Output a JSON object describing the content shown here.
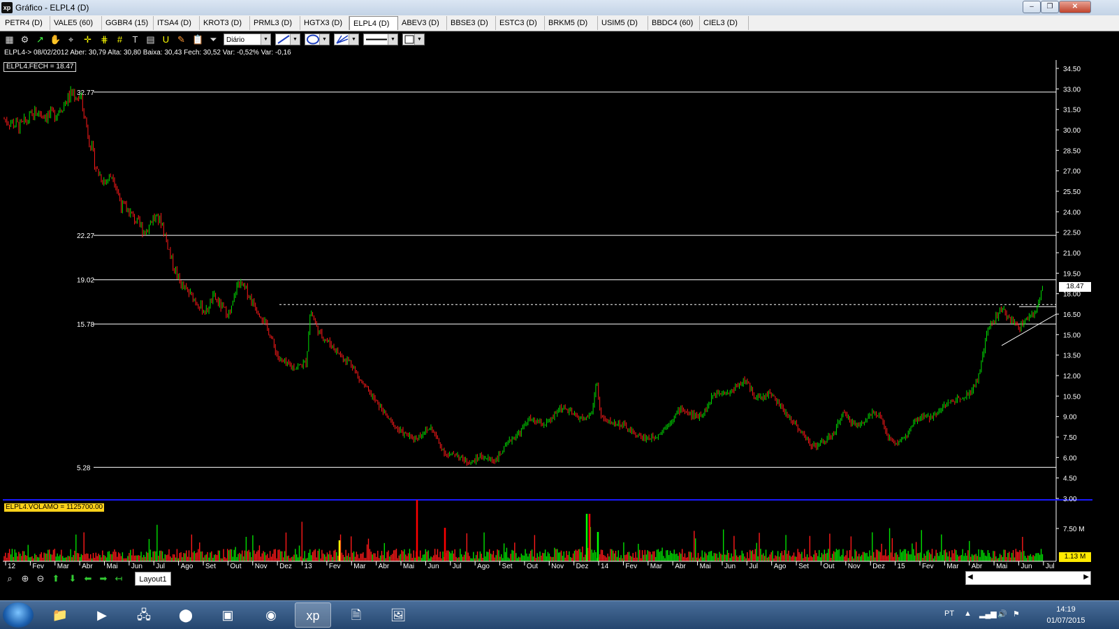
{
  "window": {
    "logo": "xp",
    "title": "Gráfico - ELPL4 (D)"
  },
  "tabs": [
    "PETR4 (D)",
    "VALE5 (60)",
    "GGBR4 (15)",
    "ITSA4 (D)",
    "KROT3 (D)",
    "PRML3 (D)",
    "HGTX3 (D)",
    "ELPL4 (D)",
    "ABEV3 (D)",
    "BBSE3 (D)",
    "ESTC3 (D)",
    "BRKM5 (D)",
    "USIM5 (D)",
    "BBDC4 (60)",
    "CIEL3 (D)"
  ],
  "active_tab": "ELPL4 (D)",
  "toolbar": {
    "period_select": "Diário"
  },
  "info_line": "ELPL4-> 08/02/2012 Aber: 30,79 Alta: 30,80 Baixa: 30,43 Fech: 30,52 Var: -0,52% Var: -0,16",
  "price_legend": "ELPL4.FECH = 18.47",
  "volume_legend": "ELPL4.VOLAMO = 1125700.00",
  "last_price_badge": "18.47",
  "volume_badge": "1.13 M",
  "layout_tab": "Layout1",
  "taskbar": {
    "lang": "PT",
    "time": "14:19",
    "date": "01/07/2015"
  },
  "colors": {
    "up": "#00e000",
    "down": "#ff1a1a",
    "line": "#ffffff",
    "volume_separator": "#1a1aff"
  },
  "chart_data": {
    "type": "candlestick",
    "price_axis": {
      "labels": [
        "34.50",
        "33.00",
        "31.50",
        "30.00",
        "28.50",
        "27.00",
        "25.50",
        "24.00",
        "22.50",
        "21.00",
        "19.50",
        "18.00",
        "16.50",
        "15.00",
        "13.50",
        "12.00",
        "10.50",
        "9.00",
        "7.50",
        "6.00",
        "4.50",
        "3.00"
      ],
      "range": [
        3.0,
        34.5
      ]
    },
    "volume_axis": {
      "labels": [
        "7.50 M"
      ]
    },
    "time_axis": [
      "12",
      "Fev",
      "Mar",
      "Abr",
      "Mai",
      "Jun",
      "Jul",
      "Ago",
      "Set",
      "Out",
      "Nov",
      "Dez",
      "13",
      "Fev",
      "Mar",
      "Abr",
      "Mai",
      "Jun",
      "Jul",
      "Ago",
      "Set",
      "Out",
      "Nov",
      "Dez",
      "14",
      "Fev",
      "Mar",
      "Abr",
      "Mai",
      "Jun",
      "Jul",
      "Ago",
      "Set",
      "Out",
      "Nov",
      "Dez",
      "15",
      "Fev",
      "Mar",
      "Abr",
      "Mai",
      "Jun",
      "Jul"
    ],
    "horizontal_levels": [
      {
        "value": 32.77,
        "label": "32.77"
      },
      {
        "value": 22.27,
        "label": "22.27"
      },
      {
        "value": 19.02,
        "label": "19.02"
      },
      {
        "value": 15.78,
        "label": "15.78"
      },
      {
        "value": 5.28,
        "label": "5.28"
      }
    ],
    "dashed_level": 17.2,
    "trend_price_path": [
      [
        0,
        30.8
      ],
      [
        4,
        30.2
      ],
      [
        8,
        31.3
      ],
      [
        12,
        31.0
      ],
      [
        15,
        32.0
      ],
      [
        17,
        32.7
      ],
      [
        19,
        32.3
      ],
      [
        21,
        29.5
      ],
      [
        23,
        27.0
      ],
      [
        25,
        26.2
      ],
      [
        27,
        26.8
      ],
      [
        29,
        24.5
      ],
      [
        31,
        24.0
      ],
      [
        33,
        23.2
      ],
      [
        35,
        22.5
      ],
      [
        37,
        23.6
      ],
      [
        39,
        23.3
      ],
      [
        40,
        22.2
      ],
      [
        42,
        20.0
      ],
      [
        44,
        18.6
      ],
      [
        46,
        18.0
      ],
      [
        48,
        17.3
      ],
      [
        50,
        16.6
      ],
      [
        52,
        17.8
      ],
      [
        54,
        17.0
      ],
      [
        56,
        16.4
      ],
      [
        58,
        18.8
      ],
      [
        60,
        18.3
      ],
      [
        62,
        17.2
      ],
      [
        64,
        16.3
      ],
      [
        66,
        15.0
      ],
      [
        68,
        13.3
      ],
      [
        70,
        12.8
      ],
      [
        72,
        12.6
      ],
      [
        74,
        12.8
      ],
      [
        75,
        13.0
      ],
      [
        76,
        16.8
      ],
      [
        78,
        15.2
      ],
      [
        80,
        14.6
      ],
      [
        82,
        14.0
      ],
      [
        84,
        13.3
      ],
      [
        86,
        13.0
      ],
      [
        88,
        11.8
      ],
      [
        90,
        11.0
      ],
      [
        92,
        10.2
      ],
      [
        94,
        9.4
      ],
      [
        96,
        8.6
      ],
      [
        98,
        8.0
      ],
      [
        100,
        7.6
      ],
      [
        102,
        7.4
      ],
      [
        104,
        7.8
      ],
      [
        106,
        8.2
      ],
      [
        108,
        7.0
      ],
      [
        110,
        6.1
      ],
      [
        112,
        6.3
      ],
      [
        114,
        5.8
      ],
      [
        116,
        5.6
      ],
      [
        118,
        6.1
      ],
      [
        120,
        5.9
      ],
      [
        122,
        5.8
      ],
      [
        124,
        6.6
      ],
      [
        126,
        7.4
      ],
      [
        128,
        7.8
      ],
      [
        130,
        8.8
      ],
      [
        132,
        8.6
      ],
      [
        134,
        8.4
      ],
      [
        136,
        8.8
      ],
      [
        138,
        9.7
      ],
      [
        140,
        9.4
      ],
      [
        142,
        9.0
      ],
      [
        144,
        8.8
      ],
      [
        146,
        9.3
      ],
      [
        147,
        11.8
      ],
      [
        148,
        9.0
      ],
      [
        150,
        8.6
      ],
      [
        152,
        8.5
      ],
      [
        154,
        8.3
      ],
      [
        156,
        7.8
      ],
      [
        158,
        7.5
      ],
      [
        160,
        7.4
      ],
      [
        162,
        7.6
      ],
      [
        164,
        8.2
      ],
      [
        166,
        8.9
      ],
      [
        168,
        9.6
      ],
      [
        170,
        9.2
      ],
      [
        172,
        9.0
      ],
      [
        174,
        9.4
      ],
      [
        176,
        10.6
      ],
      [
        178,
        10.9
      ],
      [
        180,
        10.7
      ],
      [
        182,
        11.3
      ],
      [
        184,
        11.7
      ],
      [
        186,
        10.6
      ],
      [
        188,
        10.3
      ],
      [
        190,
        10.8
      ],
      [
        192,
        10.0
      ],
      [
        194,
        9.2
      ],
      [
        196,
        8.6
      ],
      [
        198,
        7.8
      ],
      [
        200,
        7.0
      ],
      [
        202,
        6.9
      ],
      [
        204,
        7.3
      ],
      [
        206,
        7.7
      ],
      [
        208,
        9.3
      ],
      [
        210,
        8.7
      ],
      [
        212,
        8.3
      ],
      [
        214,
        8.8
      ],
      [
        216,
        9.5
      ],
      [
        218,
        8.6
      ],
      [
        220,
        7.2
      ],
      [
        222,
        7.1
      ],
      [
        224,
        7.6
      ],
      [
        226,
        8.6
      ],
      [
        228,
        9.0
      ],
      [
        230,
        8.9
      ],
      [
        232,
        9.5
      ],
      [
        234,
        9.9
      ],
      [
        236,
        10.2
      ],
      [
        238,
        10.5
      ],
      [
        240,
        10.8
      ],
      [
        242,
        12.0
      ],
      [
        244,
        15.2
      ],
      [
        246,
        16.3
      ],
      [
        248,
        16.8
      ],
      [
        250,
        16.0
      ],
      [
        252,
        15.6
      ],
      [
        254,
        16.2
      ],
      [
        256,
        16.6
      ],
      [
        258,
        18.5
      ]
    ],
    "series_count": 258
  }
}
